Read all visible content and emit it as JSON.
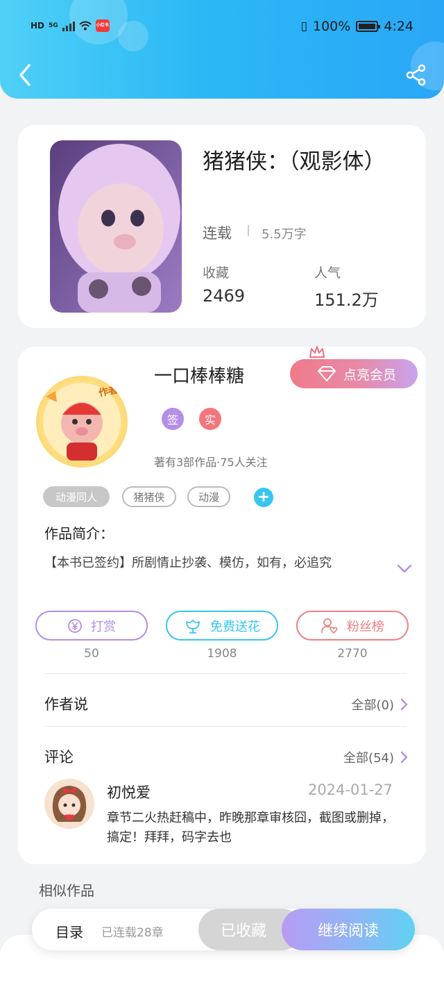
{
  "status_bar": {
    "network": "HD",
    "signal": "5G",
    "app_badge": "小红书",
    "battery": "100%",
    "time": "4:24"
  },
  "book": {
    "title": "猪猪侠：（观影体）",
    "status": "连载",
    "word_count": "5.5万字",
    "stats": [
      {
        "label": "收藏",
        "value": "2469"
      },
      {
        "label": "人气",
        "value": "151.2万"
      }
    ]
  },
  "author": {
    "avatar_label": "作者",
    "name": "一口棒棒糖",
    "vip_button": "点亮会员",
    "badges": [
      {
        "label": "签",
        "color": "#b48ee8"
      },
      {
        "label": "实",
        "color": "#f3767d"
      }
    ],
    "meta": "著有3部作品·75人关注"
  },
  "tags": [
    "动漫同人",
    "猪猪侠",
    "动漫"
  ],
  "intro": {
    "label": "作品简介：",
    "text": "【本书已签约】所剧情止抄袭、模仿，如有，必追究"
  },
  "actions": [
    {
      "label": "打赏",
      "count": "50",
      "color": "#b48ee8"
    },
    {
      "label": "免费送花",
      "count": "1908",
      "color": "#35c6ef"
    },
    {
      "label": "粉丝榜",
      "count": "2770",
      "color": "#ee7f85"
    }
  ],
  "author_says": {
    "label": "作者说",
    "more": "全部(0)"
  },
  "comments": {
    "label": "评论",
    "more": "全部(54)",
    "items": [
      {
        "user": "初悦爱",
        "date": "2024-01-27",
        "text": "章节二火热赶稿中，昨晚那章审核囧，截图或删掉，搞定！拜拜，码字去也"
      }
    ]
  },
  "similar_label": "相似作品",
  "bottom": {
    "toc": "目录",
    "chapters": "已连载28章",
    "collected": "已收藏",
    "continue": "继续阅读"
  },
  "colors": {
    "header_start": "#4fd0f6",
    "header_end": "#2aa7f7",
    "accent_purple": "#b48ee8",
    "accent_cyan": "#35c6ef",
    "accent_pink": "#ee7f85"
  }
}
